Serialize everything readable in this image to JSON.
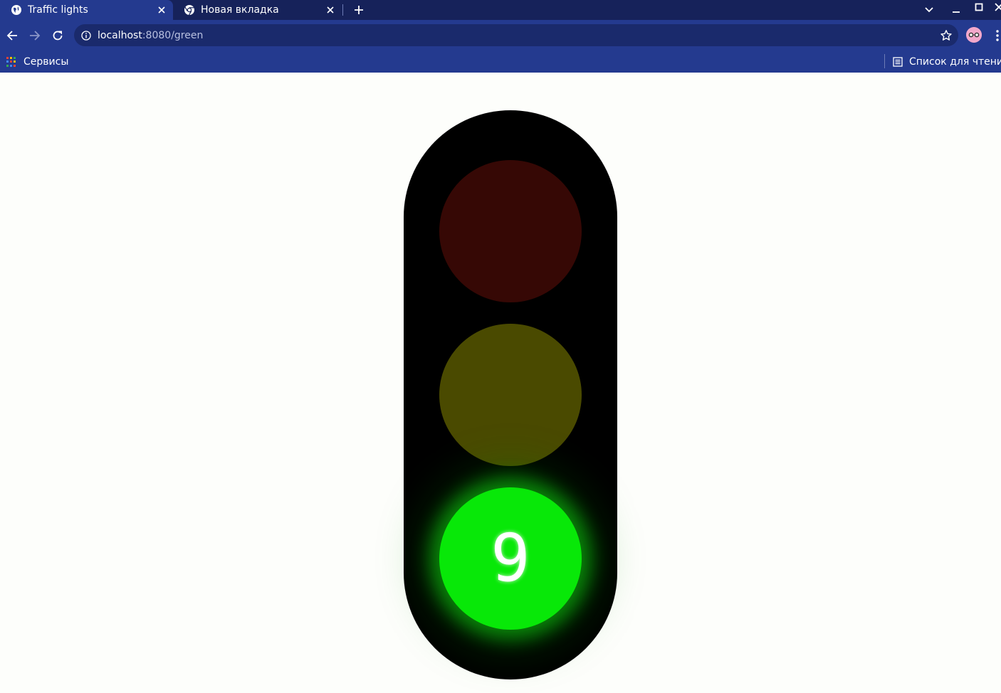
{
  "browser": {
    "tabs": [
      {
        "label": "Traffic lights",
        "active": true,
        "icon": "globe-icon"
      },
      {
        "label": "Новая вкладка",
        "active": false,
        "icon": "chrome-icon"
      }
    ],
    "address": {
      "host": "localhost",
      "rest": ":8080/green"
    },
    "bookmarks": {
      "apps_label": "Сервисы",
      "reading_list_label": "Список для чтения"
    },
    "colors": {
      "tabstrip": "#16225a",
      "toolbar": "#243a8f",
      "omnibox": "#1a2a6c"
    }
  },
  "traffic_light": {
    "state": "green",
    "countdown": "9",
    "colors": {
      "housing": "#000000",
      "red_off": "#360805",
      "yellow_off": "#4a4a00",
      "green_on": "#08e808"
    }
  }
}
